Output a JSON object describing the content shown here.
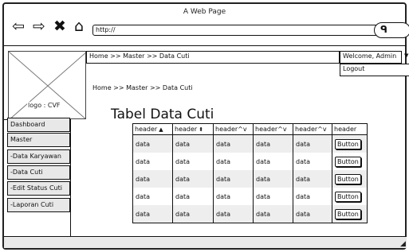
{
  "window": {
    "title": "A Web Page"
  },
  "browser": {
    "back_icon": "back-arrow-icon",
    "forward_icon": "forward-arrow-icon",
    "close_icon": "close-x-icon",
    "home_icon": "home-icon",
    "url": "http://",
    "search_icon": "search-icon"
  },
  "header": {
    "logo_text": "logo : CVF",
    "breadcrumb": "Home >> Master >> Data Cuti",
    "welcome": "Welcome, Admin",
    "logout": "Logout",
    "breadcrumb_secondary": "Home >> Master >> Data Cuti"
  },
  "sidebar": {
    "items": [
      {
        "label": "Dashboard"
      },
      {
        "label": "Master"
      },
      {
        "label": "-Data Karyawan"
      },
      {
        "label": "-Data Cuti"
      },
      {
        "label": "-Edit Status Cuti"
      },
      {
        "label": "-Laporan Cuti"
      }
    ]
  },
  "main": {
    "title": "Tabel Data Cuti",
    "table": {
      "headers": [
        "header",
        "header",
        "header^v",
        "header^v",
        "header^v",
        "header"
      ],
      "header_sort_glyphs": [
        "▲",
        "⬍",
        "",
        "",
        "",
        ""
      ],
      "rows": [
        [
          "data",
          "data",
          "data",
          "data",
          "data",
          "Button"
        ],
        [
          "data",
          "data",
          "data",
          "data",
          "data",
          "Button"
        ],
        [
          "data",
          "data",
          "data",
          "data",
          "data",
          "Button"
        ],
        [
          "data",
          "data",
          "data",
          "data",
          "data",
          "Button"
        ],
        [
          "data",
          "data",
          "data",
          "data",
          "data",
          "Button"
        ]
      ]
    }
  }
}
